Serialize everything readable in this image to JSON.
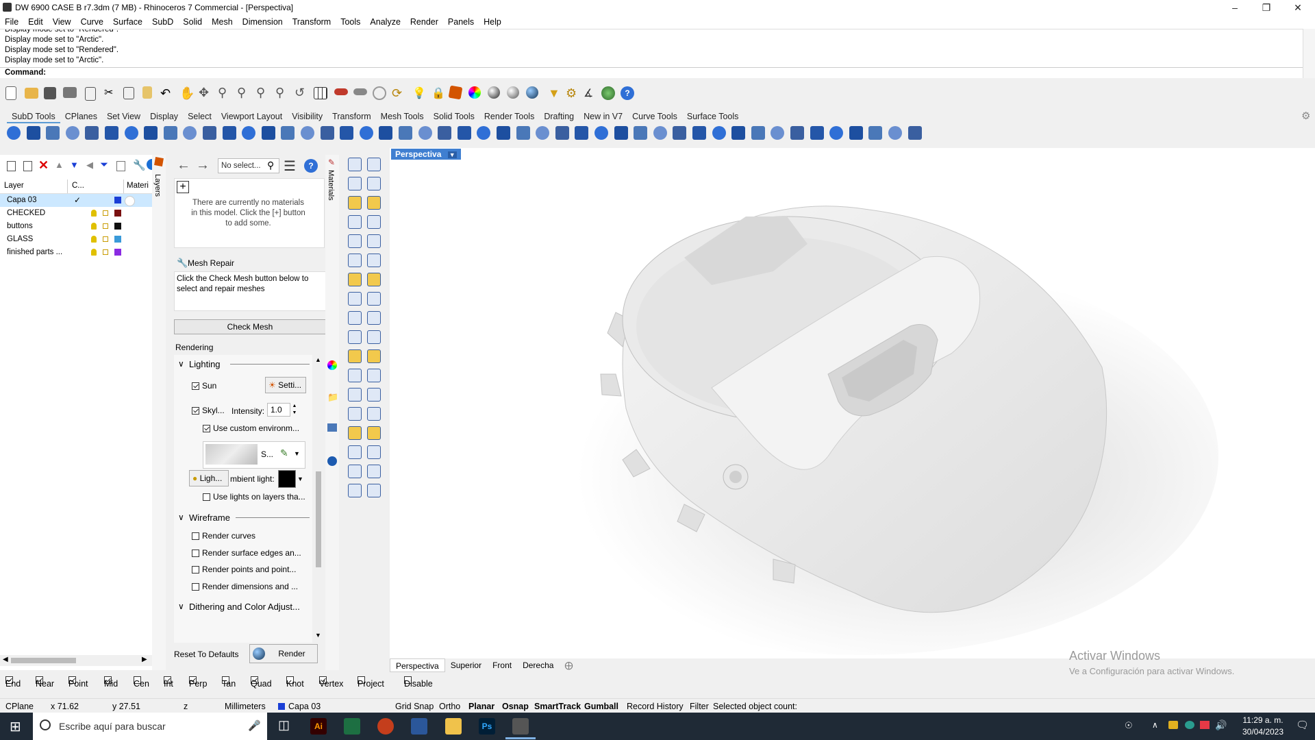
{
  "window": {
    "title": "DW 6900 CASE B r7.3dm (7 MB) - Rhinoceros 7 Commercial - [Perspectiva]"
  },
  "menu": [
    "File",
    "Edit",
    "View",
    "Curve",
    "Surface",
    "SubD",
    "Solid",
    "Mesh",
    "Dimension",
    "Transform",
    "Tools",
    "Analyze",
    "Render",
    "Panels",
    "Help"
  ],
  "command": {
    "history": [
      "Display mode set to \"Rendered\".",
      "Display mode set to \"Arctic\".",
      "Display mode set to \"Rendered\".",
      "Display mode set to \"Arctic\"."
    ],
    "prompt": "Command:"
  },
  "toolbar_tabs": [
    "SubD Tools",
    "CPlanes",
    "Set View",
    "Display",
    "Select",
    "Viewport Layout",
    "Visibility",
    "Transform",
    "Mesh Tools",
    "Solid Tools",
    "Render Tools",
    "Drafting",
    "New in V7",
    "Curve Tools",
    "Surface Tools"
  ],
  "layers": {
    "vertical_tab": "Layers",
    "headers": {
      "layer": "Layer",
      "cplane": "C...",
      "material": "Materi"
    },
    "rows": [
      {
        "name": "Capa 03",
        "current": true,
        "color": "#1a3fd6"
      },
      {
        "name": "CHECKED",
        "color": "#7a1010"
      },
      {
        "name": "buttons",
        "color": "#111111"
      },
      {
        "name": "GLASS",
        "color": "#3a9ad9"
      },
      {
        "name": "finished parts ...",
        "color": "#8a2be2"
      }
    ]
  },
  "materials": {
    "vertical_tab": "Materials",
    "search_placeholder": "No select...",
    "empty_message": "There are currently no materials in this model. Click the [+] button to add some.",
    "mesh_repair_title": "Mesh Repair",
    "mesh_repair_text": "Click the Check Mesh button below to select and repair meshes",
    "check_mesh": "Check Mesh",
    "rendering_label": "Rendering",
    "lighting": {
      "section": "Lighting",
      "sun": "Sun",
      "sun_settings": "Setti...",
      "skylight": "Skyl...",
      "intensity_label": "Intensity:",
      "intensity_value": "1.0",
      "custom_env": "Use custom environm...",
      "env_short": "S...",
      "lights_button": "Ligh...",
      "ambient_label": "mbient light:",
      "use_lights_on_layers": "Use lights on layers tha..."
    },
    "wireframe": {
      "section": "Wireframe",
      "items": [
        "Render curves",
        "Render surface edges an...",
        "Render points and point...",
        "Render dimensions and ..."
      ]
    },
    "dithering": "Dithering and Color Adjust...",
    "reset": "Reset To Defaults",
    "render": "Render"
  },
  "viewport": {
    "title": "Perspectiva",
    "tabs": [
      "Perspectiva",
      "Superior",
      "Front",
      "Derecha"
    ],
    "watermark_line1": "Activar Windows",
    "watermark_line2": "Ve a Configuración para activar Windows."
  },
  "osnap": [
    {
      "label": "End",
      "checked": true
    },
    {
      "label": "Near",
      "checked": true
    },
    {
      "label": "Point",
      "checked": true
    },
    {
      "label": "Mid",
      "checked": true
    },
    {
      "label": "Cen",
      "checked": false
    },
    {
      "label": "Int",
      "checked": true
    },
    {
      "label": "Perp",
      "checked": true
    },
    {
      "label": "Tan",
      "checked": false
    },
    {
      "label": "Quad",
      "checked": true
    },
    {
      "label": "Knot",
      "checked": false
    },
    {
      "label": "Vertex",
      "checked": true
    },
    {
      "label": "Project",
      "checked": false
    },
    {
      "label": "Disable",
      "checked": false
    }
  ],
  "status": {
    "cplane": "CPlane",
    "x": "x 71.62",
    "y": "y 27.51",
    "z": "z",
    "units": "Millimeters",
    "layer": "Capa 03",
    "grid_snap": "Grid Snap",
    "ortho": "Ortho",
    "planar": "Planar",
    "osnap": "Osnap",
    "smarttrack": "SmartTrack",
    "gumball": "Gumball",
    "record_history": "Record History",
    "filter": "Filter",
    "selected": "Selected object count:"
  },
  "taskbar": {
    "search_placeholder": "Escribe aquí para buscar",
    "time": "11:29 a. m.",
    "date": "30/04/2023",
    "ai_label": "Ai",
    "ps_label": "Ps"
  },
  "colors": {
    "accent": "#3f7fd1",
    "selection": "#cce8ff",
    "taskbar": "#1f2a36"
  }
}
